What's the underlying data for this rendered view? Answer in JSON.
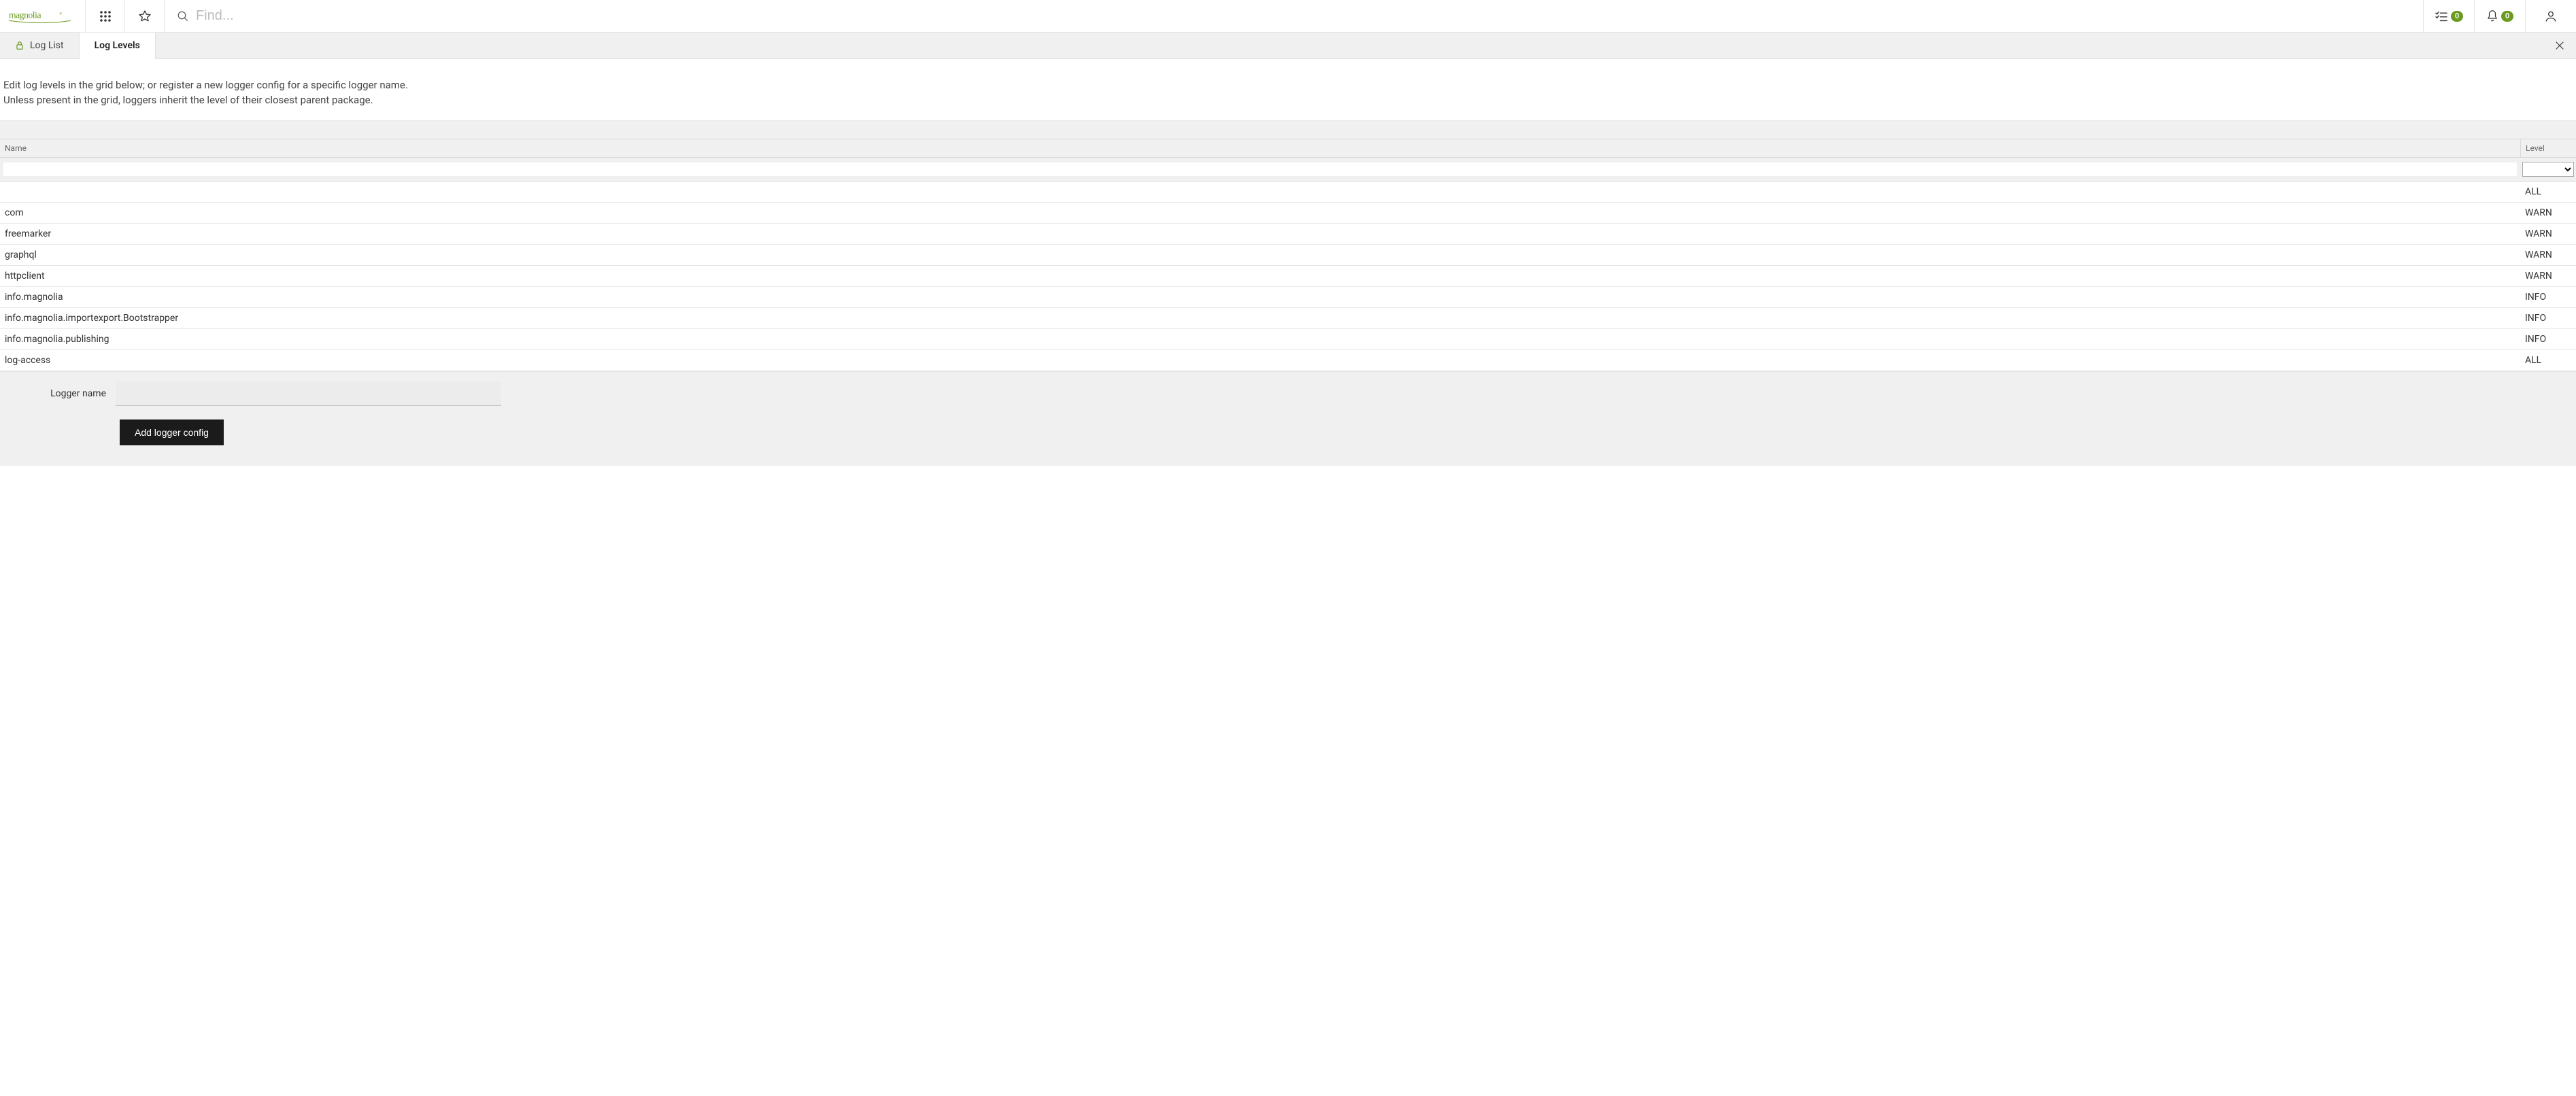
{
  "header": {
    "search_placeholder": "Find...",
    "tasks_badge": "0",
    "notifications_badge": "0"
  },
  "tabs": {
    "log_list": "Log List",
    "log_levels": "Log Levels"
  },
  "intro": {
    "line1": "Edit log levels in the grid below; or register a new logger config for a specific logger name.",
    "line2": "Unless present in the grid, loggers inherit the level of their closest parent package."
  },
  "grid": {
    "headers": {
      "name": "Name",
      "level": "Level"
    },
    "filter": {
      "name_value": "",
      "level_value": ""
    },
    "rows": [
      {
        "name": "",
        "level": "ALL"
      },
      {
        "name": "com",
        "level": "WARN"
      },
      {
        "name": "freemarker",
        "level": "WARN"
      },
      {
        "name": "graphql",
        "level": "WARN"
      },
      {
        "name": "httpclient",
        "level": "WARN"
      },
      {
        "name": "info.magnolia",
        "level": "INFO"
      },
      {
        "name": "info.magnolia.importexport.Bootstrapper",
        "level": "INFO"
      },
      {
        "name": "info.magnolia.publishing",
        "level": "INFO"
      },
      {
        "name": "log-access",
        "level": "ALL"
      }
    ]
  },
  "form": {
    "logger_name_label": "Logger name",
    "logger_name_value": "",
    "add_button": "Add logger config"
  }
}
